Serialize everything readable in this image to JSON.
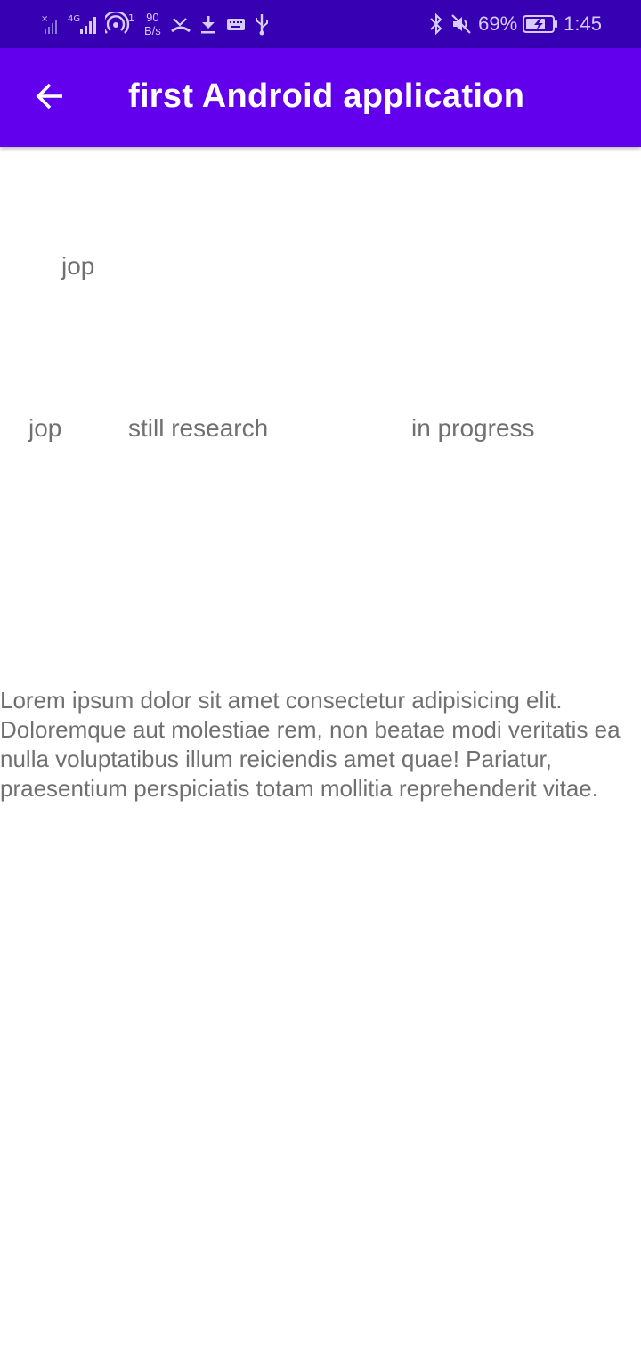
{
  "status_bar": {
    "net_speed_value": "90",
    "net_speed_unit": "B/s",
    "hotspot_count": "1",
    "network_type": "4G",
    "battery_percent": "69%",
    "time": "1:45",
    "icons": [
      "signal-x-icon",
      "signal-4g-icon",
      "hotspot-icon",
      "missed-call-icon",
      "download-icon",
      "keyboard-icon",
      "usb-icon",
      "bluetooth-icon",
      "mute-icon",
      "battery-charging-icon"
    ]
  },
  "app_bar": {
    "title": "first Android application",
    "back_icon": "arrow-back-icon",
    "background": "#6200ee",
    "status_background": "#3700b3"
  },
  "content": {
    "label_top": "jop",
    "row": {
      "col1": "jop",
      "col2": "still research",
      "col3": "in progress"
    },
    "paragraph": "Lorem ipsum dolor sit amet consectetur adipisicing elit. Doloremque aut molestiae rem, non beatae modi veritatis ea nulla voluptatibus illum reiciendis amet quae! Pariatur, praesentium perspiciatis totam mollitia reprehenderit vitae."
  }
}
